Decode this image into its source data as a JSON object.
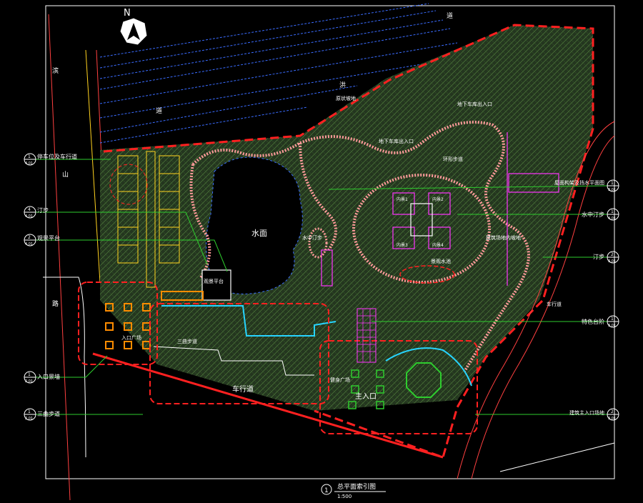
{
  "colors": {
    "background": "#000000",
    "frame": "#ffffff",
    "site_boundary": "#ff2020",
    "green_fill": "#2e4a2e",
    "path_pink": "#ff9a9a",
    "water_blue": "#3a6cff",
    "water_cyan": "#27d4ff",
    "leader_green": "#2ecc2e",
    "parking_yellow": "#ffd21f",
    "magenta": "#ff33ff",
    "orange": "#ff8c00",
    "road_red": "#ff4040"
  },
  "north": {
    "label": "N"
  },
  "map_labels": {
    "road_vertical_1": "滨",
    "road_vertical_2": "山",
    "road_vertical_3": "路",
    "river_top": "道",
    "flood_1": "洪",
    "flood_2": "道",
    "water_surface": "水面",
    "car_road": "车行道",
    "main_entrance": "主入口",
    "sightseeing_platform": "观景平台",
    "waterside_path": "水中汀步",
    "entrance_plaza": "入口广场",
    "three_step": "三曲步道",
    "fitness_plaza": "健身广场",
    "inner_1": "内景1",
    "inner_2": "内景2",
    "inner_3": "内景3",
    "inner_4": "内景4",
    "top_slope": "原状坡地",
    "top_right_note": "地下车库出入口",
    "mid_note": "地下车库出入口",
    "ring_path_note": "环形步道",
    "right_note": "建筑场地内坡地",
    "slope_road": "车行道",
    "fountain_note": "景观水池"
  },
  "callouts_left": [
    {
      "num": "1",
      "sheet": "4.01",
      "label": "停车位及车行道"
    },
    {
      "num": "4",
      "sheet": "4.01",
      "label": "汀步"
    },
    {
      "num": "2",
      "sheet": "4.01",
      "label": "观景平台"
    },
    {
      "num": "1",
      "sheet": "2.01",
      "label": "入口景墙"
    },
    {
      "num": "1",
      "sheet": "2.01",
      "label": "三曲步道"
    }
  ],
  "callouts_right": [
    {
      "num": "1",
      "sheet": "3.01",
      "label": "屋面构架及挡水平面图"
    },
    {
      "num": "1",
      "sheet": "4.01",
      "label": "水中汀步"
    },
    {
      "num": "2",
      "sheet": "3.01",
      "label": "汀步"
    },
    {
      "num": "1",
      "sheet": "3.01",
      "label": "特色台阶"
    },
    {
      "num": "2",
      "sheet": "3.01",
      "label": "建筑主入口场地"
    }
  ],
  "title": {
    "number": "1",
    "name": "总平面索引图",
    "scale": "1:500"
  }
}
